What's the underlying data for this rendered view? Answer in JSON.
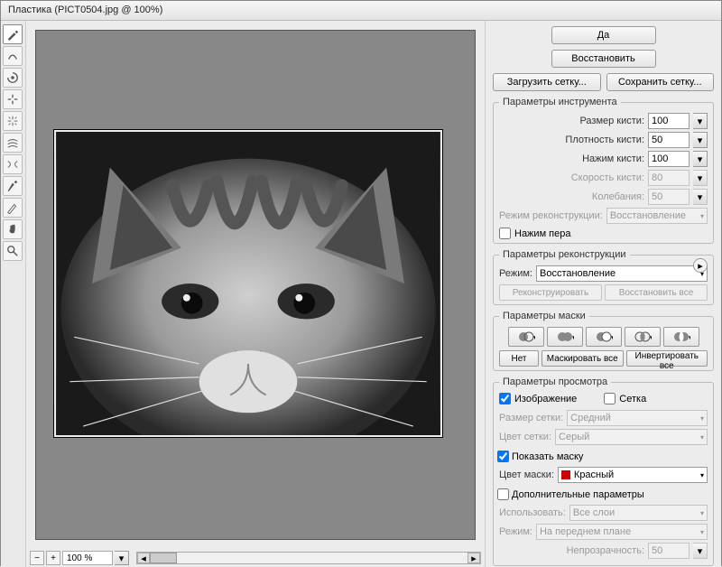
{
  "title": "Пластика (PICT0504.jpg @ 100%)",
  "zoom": "100 %",
  "buttons": {
    "ok": "Да",
    "restore": "Восстановить",
    "load_mesh": "Загрузить сетку...",
    "save_mesh": "Сохранить сетку...",
    "reconstruct": "Реконструировать",
    "restore_all": "Восстановить все",
    "none": "Нет",
    "mask_all": "Маскировать все",
    "invert_all": "Инвертировать все"
  },
  "sections": {
    "tool": "Параметры инструмента",
    "reconstruction": "Параметры реконструкции",
    "mask": "Параметры маски",
    "view": "Параметры просмотра",
    "additional": "Дополнительные параметры"
  },
  "labels": {
    "brush_size": "Размер кисти:",
    "brush_density": "Плотность кисти:",
    "brush_pressure": "Нажим кисти:",
    "brush_speed": "Скорость кисти:",
    "jitter": "Колебания:",
    "recon_mode": "Режим реконструкции:",
    "pen_pressure": "Нажим пера",
    "mode": "Режим:",
    "image": "Изображение",
    "mesh": "Сетка",
    "mesh_size": "Размер сетки:",
    "mesh_color": "Цвет сетки:",
    "show_mask": "Показать маску",
    "mask_color": "Цвет маски:",
    "use": "Использовать:",
    "mode2": "Режим:",
    "opacity": "Непрозрачность:"
  },
  "values": {
    "brush_size": "100",
    "brush_density": "50",
    "brush_pressure": "100",
    "brush_speed": "80",
    "jitter": "50",
    "recon_mode": "Восстановление",
    "mode": "Восстановление",
    "mesh_size": "Средний",
    "mesh_color": "Серый",
    "mask_color": "Красный",
    "use": "Все слои",
    "mode2": "На переднем плане",
    "opacity": "50"
  },
  "state": {
    "pen_pressure": false,
    "image": true,
    "mesh": false,
    "show_mask": true,
    "additional": false
  }
}
